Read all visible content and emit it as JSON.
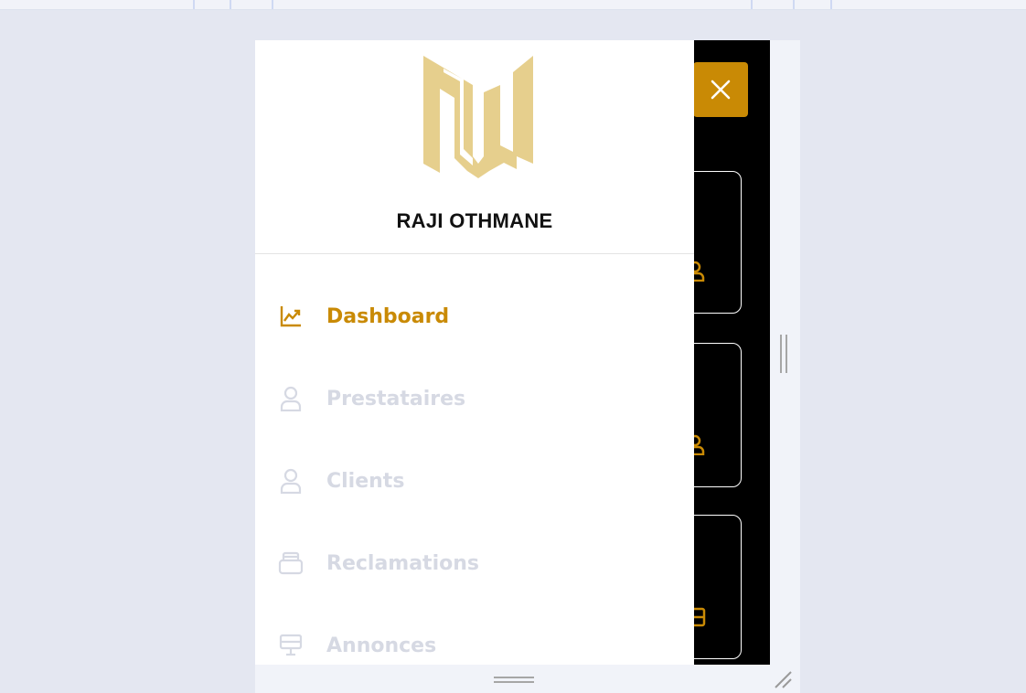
{
  "drawer": {
    "user_name": "RAJI OTHMANE",
    "logo_icon": "monogram-m-logo",
    "menu": [
      {
        "label": "Dashboard",
        "icon": "chart-line-icon",
        "active": true
      },
      {
        "label": "Prestataires",
        "icon": "user-icon",
        "active": false
      },
      {
        "label": "Clients",
        "icon": "user-icon",
        "active": false
      },
      {
        "label": "Reclamations",
        "icon": "inbox-icon",
        "active": false
      },
      {
        "label": "Annonces",
        "icon": "monitor-icon",
        "active": false
      }
    ]
  },
  "close_button": {
    "icon": "close-icon"
  },
  "colors": {
    "accent": "#c98a05",
    "logo_gold": "#e6cf8d",
    "inactive_text": "#d6d9e3",
    "canvas": "#e4e7f1",
    "viewport_bg": "#000000"
  }
}
